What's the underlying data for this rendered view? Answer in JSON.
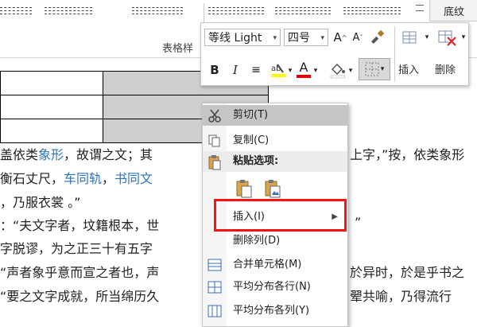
{
  "ribbon": {
    "group_label": "表格样",
    "shading_label": "底纹",
    "style_thumbs": [
      "table-style-1",
      "table-style-2",
      "table-style-3",
      "table-style-4",
      "table-style-5",
      "table-style-6"
    ]
  },
  "mini_toolbar": {
    "font_name": "等线 Light",
    "font_size": "四号",
    "bold": "B",
    "italic": "I",
    "font_color_letter": "A",
    "insert_label": "插入",
    "delete_label": "删除",
    "colors": {
      "highlight": "#ffff00",
      "font": "#e00000"
    }
  },
  "document": {
    "lines": [
      {
        "segments": [
          "盖依类",
          "象形",
          "，故谓之文；其",
          "",
          "",
          "",
          "",
          "",
          "上字，”按，依类象形"
        ]
      },
      {
        "segments": [
          "衡石丈尺，",
          "车同轨",
          "，",
          "书同文",
          ""
        ]
      },
      {
        "segments": [
          "，乃服衣裳 。”"
        ]
      },
      {
        "segments": [
          "：“夫文字者，坟籍根本，世",
          "”"
        ]
      },
      {
        "segments": [
          "字脱谬，为之正三十有五字"
        ]
      },
      {
        "segments": [
          "“声者象乎意而宣之者也，声",
          "於异时，於是乎书之"
        ]
      },
      {
        "segments": [
          "“要之文字成就，所当绵历久",
          "翚共喻，乃得流行"
        ]
      }
    ]
  },
  "context_menu": {
    "items": [
      {
        "label": "剪切(T)",
        "icon": "scissors-icon"
      },
      {
        "label": "复制(C)",
        "icon": "copy-icon"
      },
      {
        "label": "粘贴选项:",
        "icon": "paste-icon"
      },
      {
        "label": "插入(I)",
        "icon": ""
      },
      {
        "label": "删除列(D)",
        "icon": ""
      },
      {
        "label": "合并单元格(M)",
        "icon": "merge-cells-icon"
      },
      {
        "label": "平均分布各行(N)",
        "icon": "distribute-rows-icon"
      },
      {
        "label": "平均分布各列(Y)",
        "icon": "distribute-columns-icon"
      }
    ],
    "highlight_color": "#ff1111"
  }
}
